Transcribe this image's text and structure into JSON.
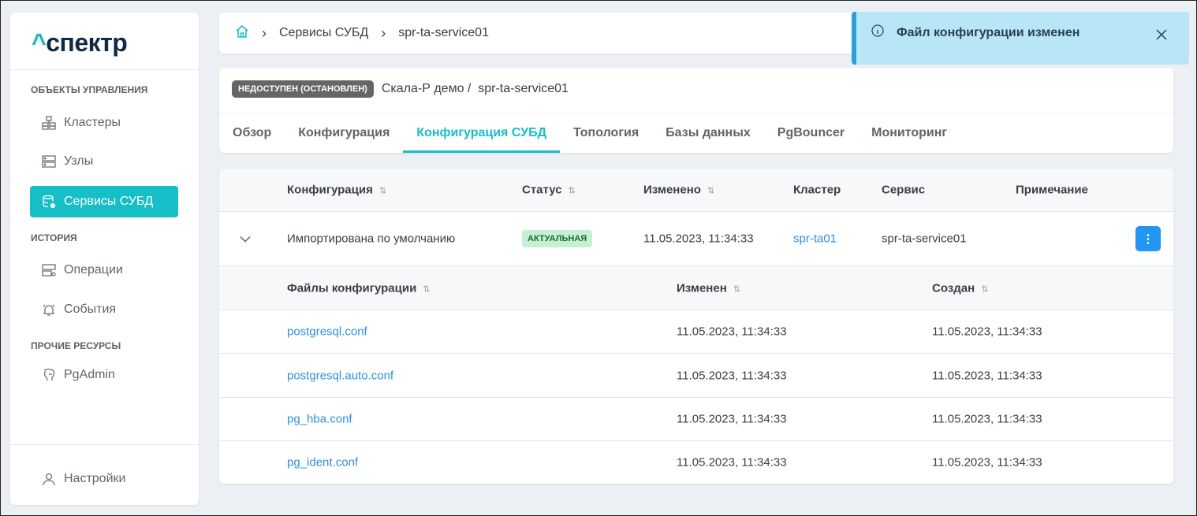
{
  "logo": {
    "caret": "^",
    "text": "спектр"
  },
  "sidebar": {
    "sections": [
      "ОБЪЕКТЫ УПРАВЛЕНИЯ",
      "ИСТОРИЯ",
      "ПРОЧИЕ РЕСУРСЫ"
    ],
    "items": [
      {
        "label": "Кластеры"
      },
      {
        "label": "Узлы"
      },
      {
        "label": "Сервисы СУБД"
      },
      {
        "label": "Операции"
      },
      {
        "label": "События"
      },
      {
        "label": "PgAdmin"
      }
    ],
    "settings": "Настройки"
  },
  "breadcrumbs": [
    "Сервисы СУБД",
    "spr-ta-service01"
  ],
  "toast": {
    "message": "Файл конфигурации изменен"
  },
  "header": {
    "status": "НЕДОСТУПЕН (ОСТАНОВЛЕН)",
    "path": "Скала-Р демо /  spr-ta-service01"
  },
  "tabs": [
    "Обзор",
    "Конфигурация",
    "Конфигурация СУБД",
    "Топология",
    "Базы данных",
    "PgBouncer",
    "Мониторинг"
  ],
  "table": {
    "columns": [
      "Конфигурация",
      "Статус",
      "Изменено",
      "Кластер",
      "Сервис",
      "Примечание"
    ],
    "row": {
      "config": "Импортирована по умолчанию",
      "status": "АКТУАЛЬНАЯ",
      "changed": "11.05.2023, 11:34:33",
      "cluster": "spr-ta01",
      "service": "spr-ta-service01",
      "note": ""
    },
    "files_columns": [
      "Файлы конфигурации",
      "Изменен",
      "Создан"
    ],
    "files": [
      {
        "name": "postgresql.conf",
        "changed": "11.05.2023, 11:34:33",
        "created": "11.05.2023, 11:34:33"
      },
      {
        "name": "postgresql.auto.conf",
        "changed": "11.05.2023, 11:34:33",
        "created": "11.05.2023, 11:34:33"
      },
      {
        "name": "pg_hba.conf",
        "changed": "11.05.2023, 11:34:33",
        "created": "11.05.2023, 11:34:33"
      },
      {
        "name": "pg_ident.conf",
        "changed": "11.05.2023, 11:34:33",
        "created": "11.05.2023, 11:34:33"
      }
    ]
  }
}
